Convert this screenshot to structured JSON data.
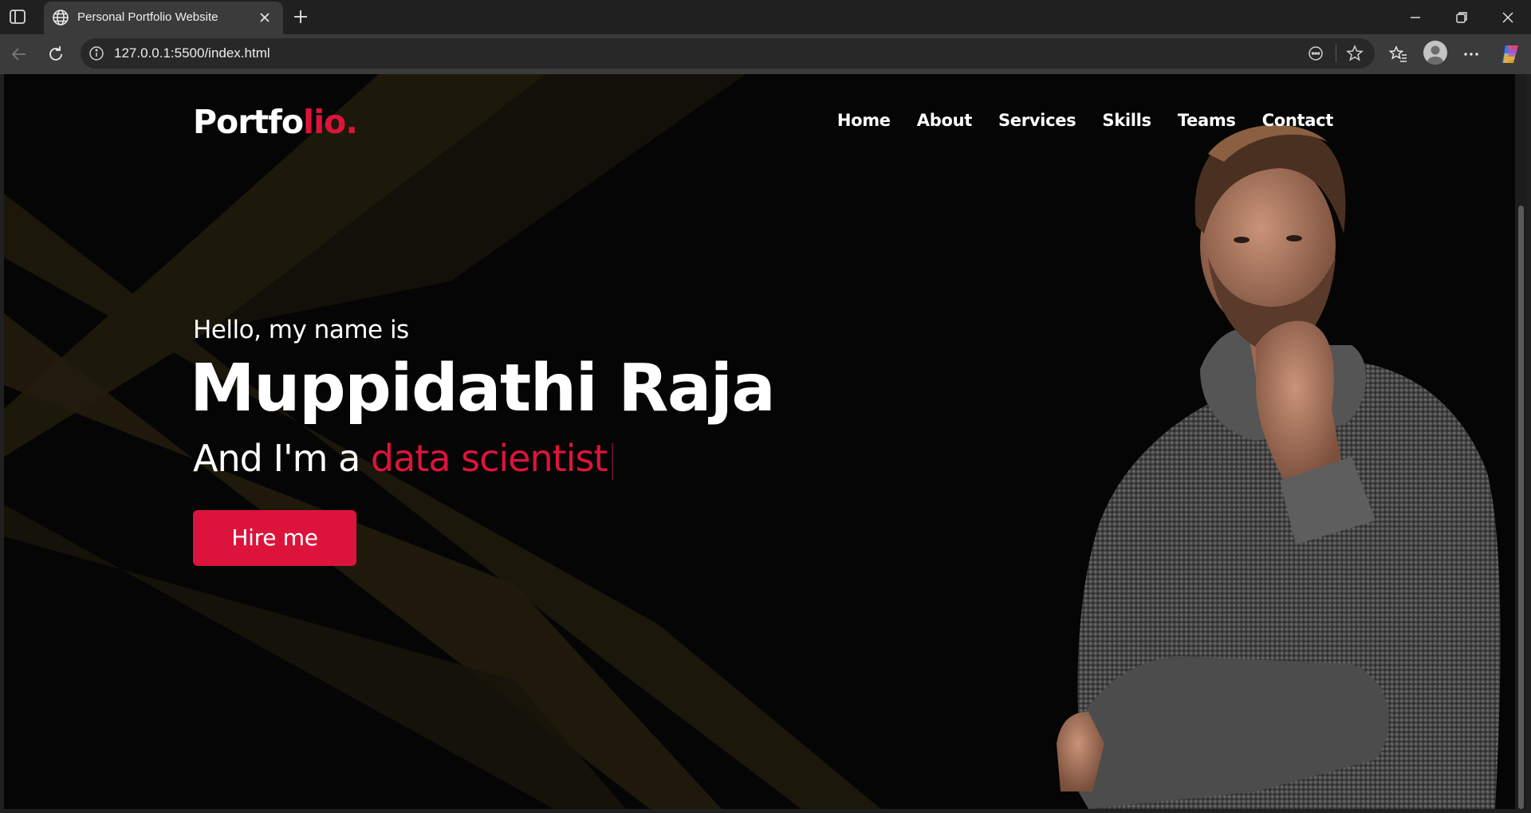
{
  "browser": {
    "tab_title": "Personal Portfolio Website",
    "url": "127.0.0.1:5500/index.html"
  },
  "page": {
    "logo": {
      "main": "Portfo",
      "accent": "lio."
    },
    "nav": [
      "Home",
      "About",
      "Services",
      "Skills",
      "Teams",
      "Contact"
    ],
    "hero": {
      "greeting": "Hello, my name is",
      "name": "Muppidathi Raja",
      "role_prefix": "And I'm a ",
      "role": "data scientist",
      "cta": "Hire me"
    },
    "colors": {
      "accent": "#dc143c",
      "background": "#050505",
      "text": "#ffffff"
    }
  }
}
